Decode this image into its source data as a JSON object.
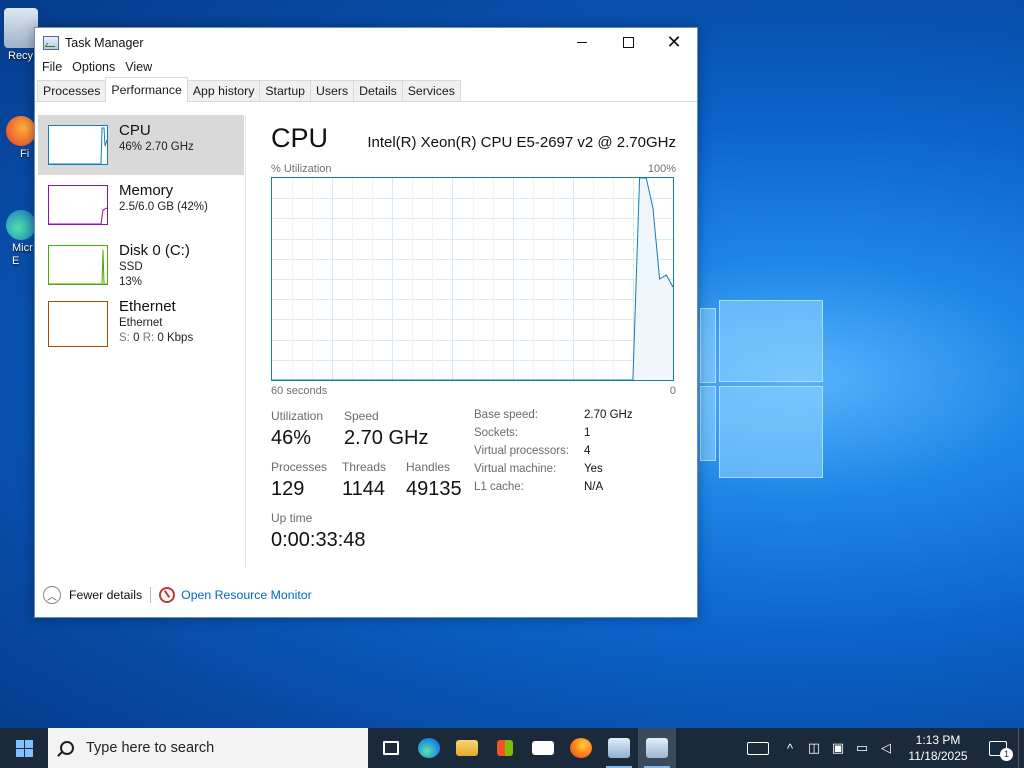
{
  "desktop": {
    "icons": [
      {
        "label": "Recy",
        "name": "recycle-bin-icon"
      },
      {
        "label": "Fi",
        "name": "firefox-desktop-icon"
      },
      {
        "label": "Micr E",
        "name": "edge-desktop-icon"
      }
    ]
  },
  "window": {
    "title": "Task Manager",
    "controls": {
      "minimize": "",
      "maximize": "",
      "close": "✕"
    },
    "menu": [
      "File",
      "Options",
      "View"
    ],
    "tabs": [
      "Processes",
      "Performance",
      "App history",
      "Startup",
      "Users",
      "Details",
      "Services"
    ],
    "active_tab": "Performance"
  },
  "sidebar": {
    "items": [
      {
        "name": "CPU",
        "line1": "46% 2.70 GHz",
        "line2": "",
        "color": "#117dbb"
      },
      {
        "name": "Memory",
        "line1": "2.5/6.0 GB (42%)",
        "line2": "",
        "color": "#8b12ae"
      },
      {
        "name": "Disk 0 (C:)",
        "line1": "SSD",
        "line2": "13%",
        "color": "#4da60c"
      },
      {
        "name": "Ethernet",
        "line1": "Ethernet",
        "line2_prefix_s": "S:",
        "line2_s": "0",
        "line2_prefix_r": "R:",
        "line2_r": "0 Kbps",
        "color": "#a74f01"
      }
    ]
  },
  "main": {
    "heading": "CPU",
    "model": "Intel(R) Xeon(R) CPU E5-2697 v2 @ 2.70GHz",
    "graph": {
      "title": "% Utilization",
      "max_label": "100%",
      "time_label": "60 seconds",
      "min_label": "0",
      "color": "#117dbb",
      "fill": "#f1f6fa"
    },
    "stats": {
      "utilization_label": "Utilization",
      "utilization": "46%",
      "speed_label": "Speed",
      "speed": "2.70 GHz",
      "processes_label": "Processes",
      "processes": "129",
      "threads_label": "Threads",
      "threads": "1144",
      "handles_label": "Handles",
      "handles": "49135",
      "uptime_label": "Up time",
      "uptime": "0:00:33:48"
    },
    "info": [
      {
        "key": "Base speed:",
        "value": "2.70 GHz"
      },
      {
        "key": "Sockets:",
        "value": "1"
      },
      {
        "key": "Virtual processors:",
        "value": "4"
      },
      {
        "key": "Virtual machine:",
        "value": "Yes"
      },
      {
        "key": "L1 cache:",
        "value": "N/A"
      }
    ]
  },
  "footer": {
    "fewer_details": "Fewer details",
    "open_resource_monitor": "Open Resource Monitor"
  },
  "chart_data": {
    "type": "area",
    "title": "% Utilization",
    "xlabel": "60 seconds",
    "x": [
      60,
      59,
      58,
      57,
      56,
      55,
      54,
      53,
      52,
      51,
      50,
      49,
      48,
      47,
      46,
      45,
      44,
      43,
      42,
      41,
      40,
      39,
      38,
      37,
      36,
      35,
      34,
      33,
      32,
      31,
      30,
      29,
      28,
      27,
      26,
      25,
      24,
      23,
      22,
      21,
      20,
      19,
      18,
      17,
      16,
      15,
      14,
      13,
      12,
      11,
      10,
      9,
      8,
      7,
      6,
      5,
      4,
      3,
      2,
      1,
      0
    ],
    "series": [
      {
        "values": [
          0,
          0,
          0,
          0,
          0,
          0,
          0,
          0,
          0,
          0,
          0,
          0,
          0,
          0,
          0,
          0,
          0,
          0,
          0,
          0,
          0,
          0,
          0,
          0,
          0,
          0,
          0,
          0,
          0,
          0,
          0,
          0,
          0,
          0,
          0,
          0,
          0,
          0,
          0,
          0,
          0,
          0,
          0,
          0,
          0,
          0,
          0,
          0,
          0,
          0,
          0,
          0,
          0,
          0,
          0,
          100,
          100,
          85,
          50,
          52,
          46
        ]
      }
    ],
    "ylim": [
      0,
      100
    ]
  },
  "taskbar": {
    "search_placeholder": "Type here to search",
    "apps": [
      {
        "name": "task-view-icon",
        "color": "#ffffff"
      },
      {
        "name": "edge-icon",
        "color": "#1fa0e0"
      },
      {
        "name": "file-explorer-icon",
        "color": "#f2c14e"
      },
      {
        "name": "store-icon",
        "color": "#cfd8e3"
      },
      {
        "name": "mail-icon",
        "color": "#ffffff"
      },
      {
        "name": "firefox-icon",
        "color": "#ff7a1a"
      },
      {
        "name": "control-panel-icon",
        "color": "#9fb8d6"
      },
      {
        "name": "task-manager-icon",
        "color": "#b8c9dd"
      }
    ],
    "clock_time": "1:13 PM",
    "clock_date": "11/18/2025",
    "notification_count": "1"
  }
}
